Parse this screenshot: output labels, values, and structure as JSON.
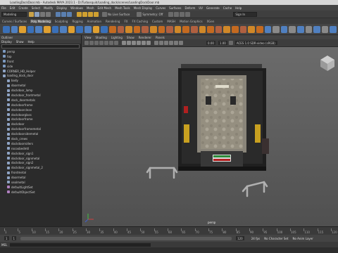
{
  "window": {
    "title": "LoadingDockDoor.mb - Autodesk MAYA 2023.1 - D:/Turbosquid/Loading_dock/scenes/LoadingDockDoor.mb"
  },
  "menubar": [
    "File",
    "Edit",
    "Create",
    "Select",
    "Modify",
    "Display",
    "Windows",
    "Mesh",
    "Edit Mesh",
    "Mesh Tools",
    "Mesh Display",
    "Curves",
    "Surfaces",
    "Deform",
    "UV",
    "Generate",
    "Cache",
    "Help"
  ],
  "status": {
    "workspace": "Modeling",
    "snap_label": "No Live Surface",
    "symmetry": "Symmetry: Off",
    "sign_in": "Sign In"
  },
  "shelf_tabs": [
    {
      "label": "Curves / Surfaces",
      "active": false
    },
    {
      "label": "Poly Modeling",
      "active": true
    },
    {
      "label": "Sculpting",
      "active": false
    },
    {
      "label": "Rigging",
      "active": false
    },
    {
      "label": "Animation",
      "active": false
    },
    {
      "label": "Rendering",
      "active": false
    },
    {
      "label": "FX",
      "active": false
    },
    {
      "label": "FX Caching",
      "active": false
    },
    {
      "label": "Custom",
      "active": false
    },
    {
      "label": "MASH",
      "active": false
    },
    {
      "label": "Motion Graphics",
      "active": false
    },
    {
      "label": "XGen",
      "active": false
    }
  ],
  "outliner": {
    "title": "Outliner",
    "menu": [
      "Display",
      "Show",
      "Help"
    ],
    "search_placeholder": "",
    "items": [
      {
        "label": "persp",
        "sel": false
      },
      {
        "label": "top",
        "sel": false
      },
      {
        "label": "front",
        "sel": false
      },
      {
        "label": "side",
        "sel": false
      },
      {
        "label": "CORNER_HD_Helper",
        "sel": false
      },
      {
        "label": "loading_dock_door",
        "sel": false
      },
      {
        "label": "body",
        "sel": false
      },
      {
        "label": "doormetal",
        "sel": false
      },
      {
        "label": "dockdoor_lamp",
        "sel": false
      },
      {
        "label": "dockdoor_frontmetal",
        "sel": false
      },
      {
        "label": "dock_doormetals",
        "sel": false
      },
      {
        "label": "dockdoorframe",
        "sel": false
      },
      {
        "label": "dockdoorclean",
        "sel": false
      },
      {
        "label": "dockdoorglass",
        "sel": false
      },
      {
        "label": "dockdoorframe",
        "sel": false
      },
      {
        "label": "dockdoor",
        "sel": false
      },
      {
        "label": "dockdoorframemetal",
        "sel": false
      },
      {
        "label": "dockdoorsidemetal",
        "sel": false
      },
      {
        "label": "dock_crews",
        "sel": false
      },
      {
        "label": "dockdoorrollers",
        "sel": false
      },
      {
        "label": "rocoobedmtl",
        "sel": false
      },
      {
        "label": "dockdoor_sign1",
        "sel": false
      },
      {
        "label": "dockdoor_signmetal",
        "sel": false
      },
      {
        "label": "dockdoor_sign2",
        "sel": false
      },
      {
        "label": "dockdoor_signmetal_2",
        "sel": false
      },
      {
        "label": "frontmetal",
        "sel": false
      },
      {
        "label": "doormetal",
        "sel": false
      },
      {
        "label": "sealmetal",
        "sel": false
      },
      {
        "label": "defaultLightSet",
        "sel": false
      },
      {
        "label": "defaultObjectSet",
        "sel": false
      }
    ]
  },
  "viewport": {
    "menu": [
      "View",
      "Shading",
      "Lighting",
      "Show",
      "Renderer",
      "Panels"
    ],
    "near_value": "0.00",
    "far_value": "1.00",
    "colorspace": "ACES 1.0 SDR-video (sRGB)",
    "camera_label": "persp"
  },
  "timeline": {
    "ticks": [
      "1",
      "5",
      "10",
      "15",
      "20",
      "25",
      "30",
      "35",
      "40",
      "45",
      "50",
      "55",
      "60",
      "65",
      "70",
      "75",
      "80",
      "85",
      "90",
      "95",
      "100",
      "105",
      "110",
      "115",
      "120"
    ],
    "start": "1",
    "end": "120",
    "current": "1"
  },
  "cmdline": {
    "mel": "MEL",
    "fps": "24 fps",
    "character": "No Character Set",
    "anim_layer": "No Anim Layer"
  }
}
